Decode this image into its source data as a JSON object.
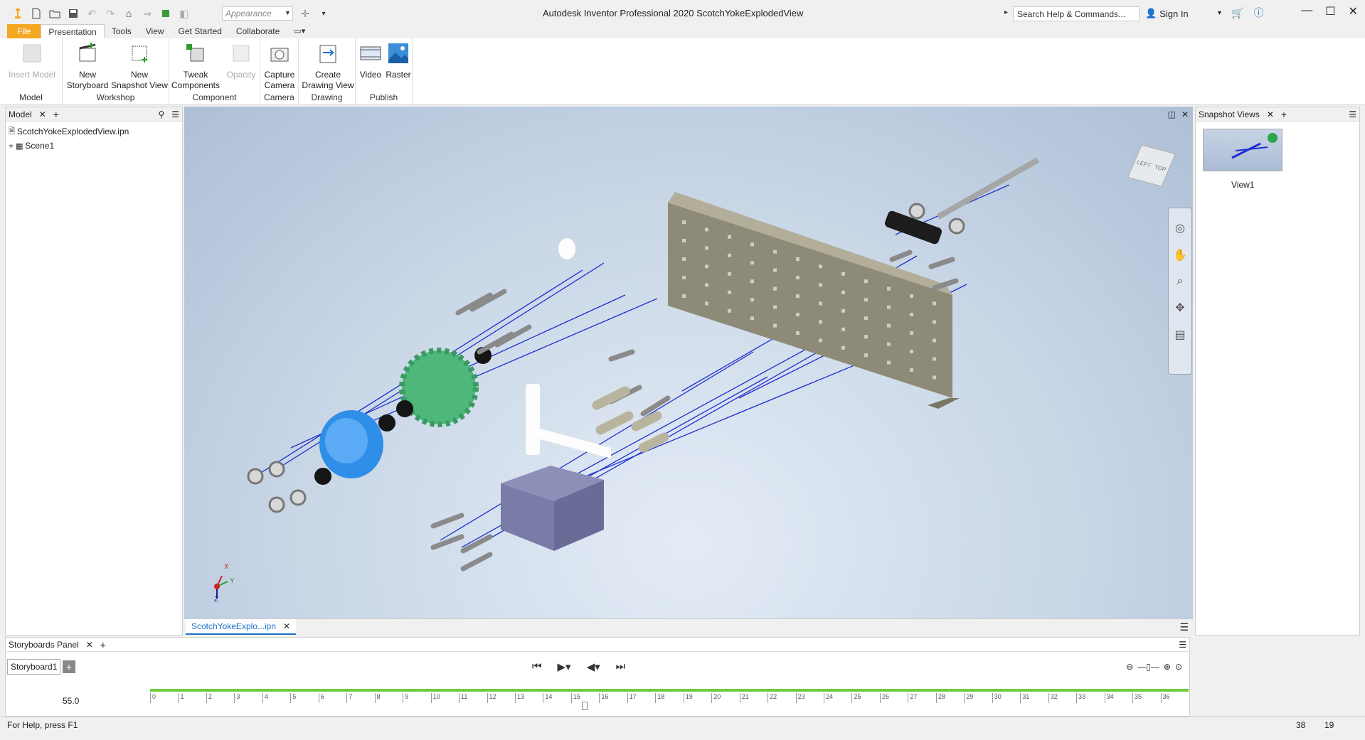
{
  "window": {
    "title": "Autodesk Inventor Professional 2020    ScotchYokeExplodedView"
  },
  "qat": {
    "appearance_placeholder": "Appearance"
  },
  "search": {
    "placeholder": "Search Help & Commands..."
  },
  "account": {
    "sign_in": "Sign In"
  },
  "ribbon_tabs": [
    {
      "label": "File"
    },
    {
      "label": "Presentation"
    },
    {
      "label": "Tools"
    },
    {
      "label": "View"
    },
    {
      "label": "Get Started"
    },
    {
      "label": "Collaborate"
    }
  ],
  "ribbon": {
    "groups": {
      "model": "Model",
      "workshop": "Workshop",
      "component": "Component",
      "camera": "Camera",
      "drawing": "Drawing",
      "publish": "Publish"
    },
    "buttons": {
      "insert_model": "Insert Model",
      "new_storyboard_1": "New",
      "new_storyboard_2": "Storyboard",
      "new_snapshot_1": "New",
      "new_snapshot_2": "Snapshot View",
      "tweak_1": "Tweak",
      "tweak_2": "Components",
      "opacity": "Opacity",
      "capture_1": "Capture",
      "capture_2": "Camera",
      "create_1": "Create",
      "create_2": "Drawing View",
      "video": "Video",
      "raster": "Raster"
    }
  },
  "model_browser": {
    "title": "Model",
    "items": [
      {
        "label": "ScotchYokeExplodedView.ipn"
      },
      {
        "label": "Scene1"
      }
    ]
  },
  "viewcube": {
    "face_top": "TOP",
    "face_left": "LEFT"
  },
  "triad": {
    "x": "X",
    "y": "Y",
    "z": "Z"
  },
  "document_tab": {
    "label": "ScotchYokeExplo...ipn"
  },
  "snapshot_views": {
    "title": "Snapshot Views",
    "items": [
      {
        "label": "View1"
      }
    ]
  },
  "storyboards": {
    "title": "Storyboards Panel",
    "tab": "Storyboard1",
    "time": "55.0",
    "ticks": [
      "0",
      "1",
      "2",
      "3",
      "4",
      "5",
      "6",
      "7",
      "8",
      "9",
      "10",
      "11",
      "12",
      "13",
      "14",
      "15",
      "16",
      "17",
      "18",
      "19",
      "20",
      "21",
      "22",
      "23",
      "24",
      "25",
      "26",
      "27",
      "28",
      "29",
      "30",
      "31",
      "32",
      "33",
      "34",
      "35",
      "36"
    ]
  },
  "status": {
    "help": "For Help, press F1",
    "num1": "38",
    "num2": "19"
  },
  "colors": {
    "file_tab": "#f5a623",
    "accent": "#1a73c8",
    "timeline_green": "#6ecb3c"
  }
}
